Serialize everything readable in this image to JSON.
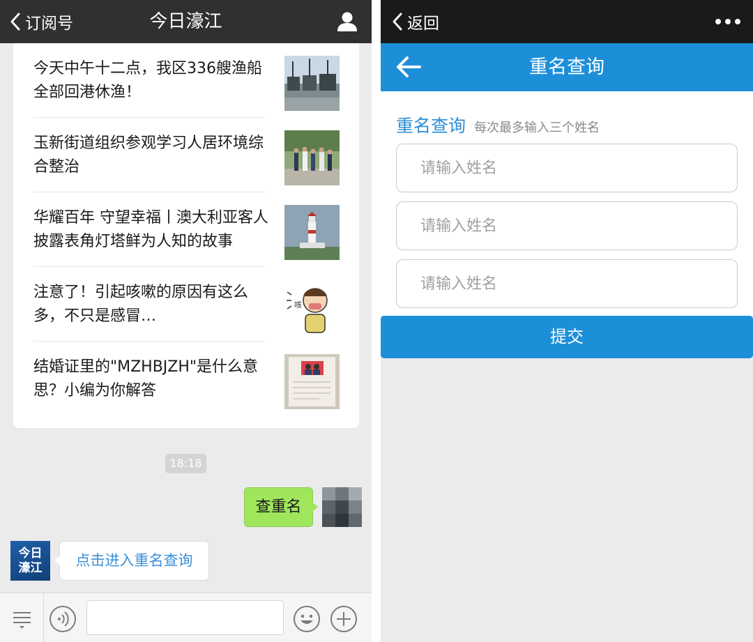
{
  "left": {
    "nav": {
      "back_label": "订阅号",
      "title": "今日濠江"
    },
    "articles": [
      {
        "title": "今天中午十二点，我区336艘渔船全部回港休渔！",
        "thumb": "harbor-fishing-boats"
      },
      {
        "title": "玉新街道组织参观学习人居环境综合整治",
        "thumb": "people-walking-street"
      },
      {
        "title": "华耀百年 守望幸福丨澳大利亚客人披露表角灯塔鲜为人知的故事",
        "thumb": "lighthouse"
      },
      {
        "title": "注意了！引起咳嗽的原因有这么多，不只是感冒…",
        "thumb": "coughing-cartoon",
        "thumb_text": "咳"
      },
      {
        "title": "结婚证里的\"MZHBJZH\"是什么意思？小编为你解答",
        "thumb": "marriage-certificate"
      }
    ],
    "timestamp": "18:18",
    "my_message": "查重名",
    "bot_avatar": {
      "line1": "今日",
      "line2": "濠江"
    },
    "bot_message": "点击进入重名查询"
  },
  "right": {
    "top": {
      "back_label": "返回"
    },
    "header": {
      "title": "重名查询"
    },
    "form": {
      "label": "重名查询",
      "hint": "每次最多输入三个姓名",
      "placeholders": [
        "请输入姓名",
        "请输入姓名",
        "请输入姓名"
      ]
    },
    "submit_label": "提交"
  },
  "colors": {
    "wechat_nav": "#2f3031",
    "chat_bg": "#ebebeb",
    "my_bubble": "#a0e65c",
    "link_blue": "#3b8fd6",
    "page_blue": "#1d8fd9"
  }
}
